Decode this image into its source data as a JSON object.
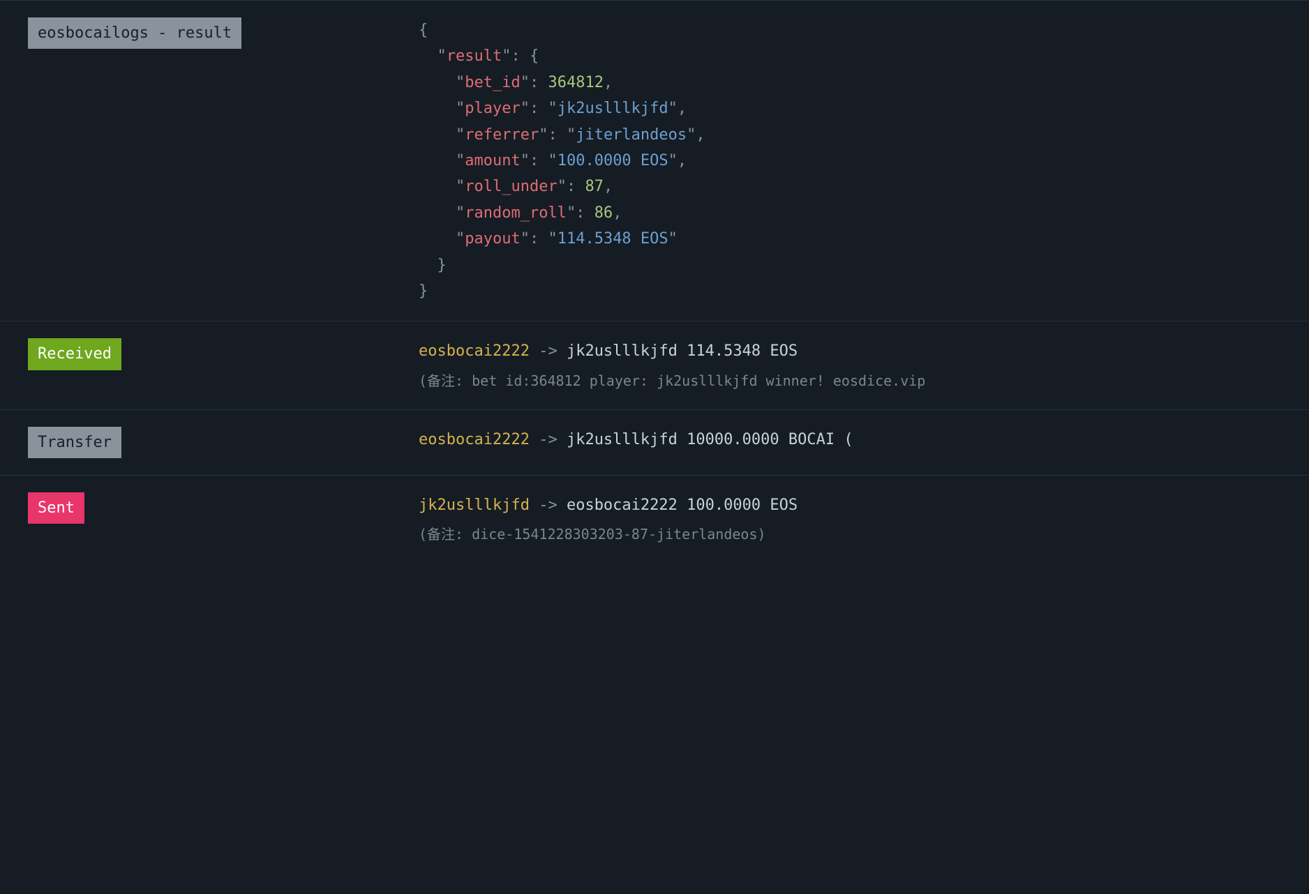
{
  "action_row": {
    "badge": "eosbocailogs - result",
    "json": {
      "result": {
        "bet_id": 364812,
        "player": "jk2uslllkjfd",
        "referrer": "jiterlandeos",
        "amount": "100.0000 EOS",
        "roll_under": 87,
        "random_roll": 86,
        "payout": "114.5348 EOS"
      }
    }
  },
  "received_row": {
    "badge": "Received",
    "from": "eosbocai2222",
    "arrow": "->",
    "to": "jk2uslllkjfd",
    "amount": "114.5348 EOS",
    "memo": "(备注: bet id:364812 player: jk2uslllkjfd winner! eosdice.vip"
  },
  "transfer_row": {
    "badge": "Transfer",
    "from": "eosbocai2222",
    "arrow": "->",
    "to": "jk2uslllkjfd",
    "amount": "10000.0000 BOCAI ("
  },
  "sent_row": {
    "badge": "Sent",
    "from": "jk2uslllkjfd",
    "arrow": "->",
    "to": "eosbocai2222",
    "amount": "100.0000 EOS",
    "memo": "(备注: dice-1541228303203-87-jiterlandeos)"
  }
}
